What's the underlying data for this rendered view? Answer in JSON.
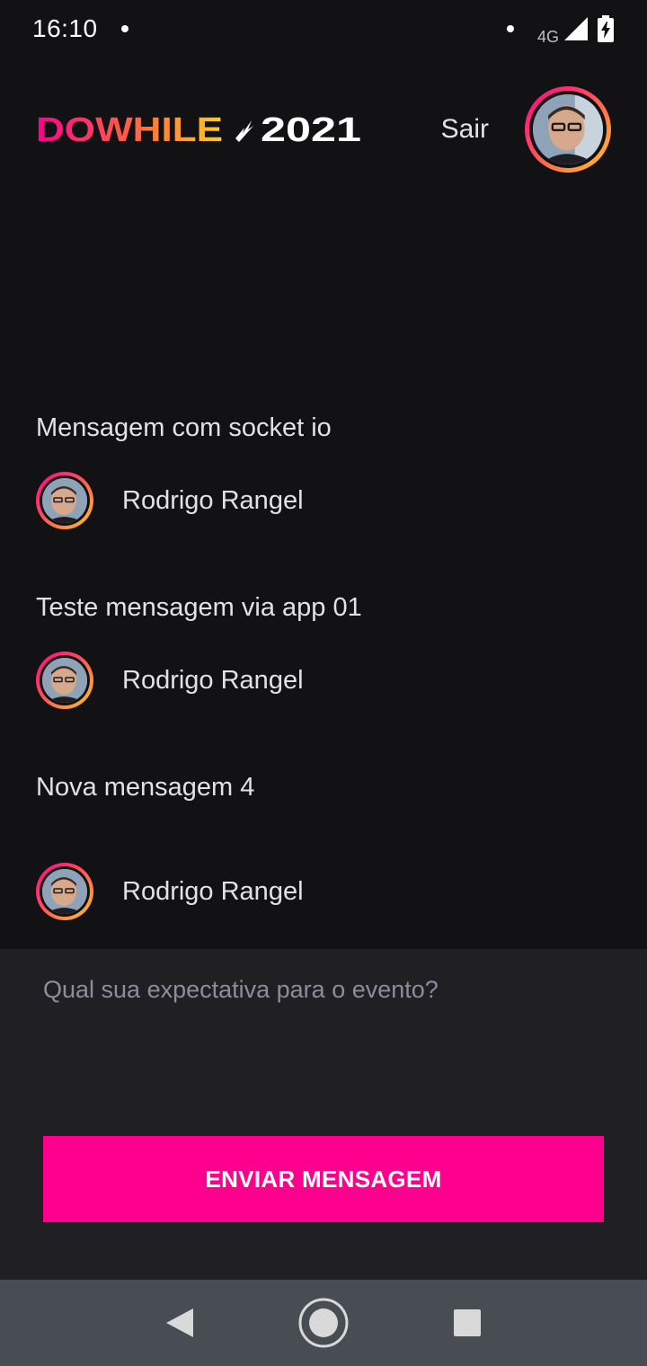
{
  "status_bar": {
    "time": "16:10",
    "network": "4G"
  },
  "header": {
    "logo_text": "DOWHILE",
    "logo_year": "2021",
    "sign_out_label": "Sair"
  },
  "messages": [
    {
      "text": "Mensagem com socket io",
      "author": "Rodrigo Rangel"
    },
    {
      "text": "Teste mensagem via app 01",
      "author": "Rodrigo Rangel"
    },
    {
      "text": "Nova mensagem 4",
      "author": "Rodrigo Rangel"
    }
  ],
  "compose": {
    "placeholder": "Qual sua expectativa para o evento?",
    "value": "",
    "send_label": "ENVIAR MENSAGEM"
  },
  "colors": {
    "background": "#121214",
    "compose_background": "#202024",
    "accent": "#ff008e",
    "gradient_end": "#ffcd1e",
    "nav_bar": "#484c53"
  },
  "icons": {
    "nav_back": "back-triangle-icon",
    "nav_home": "home-circle-icon",
    "nav_recents": "recents-square-icon"
  }
}
